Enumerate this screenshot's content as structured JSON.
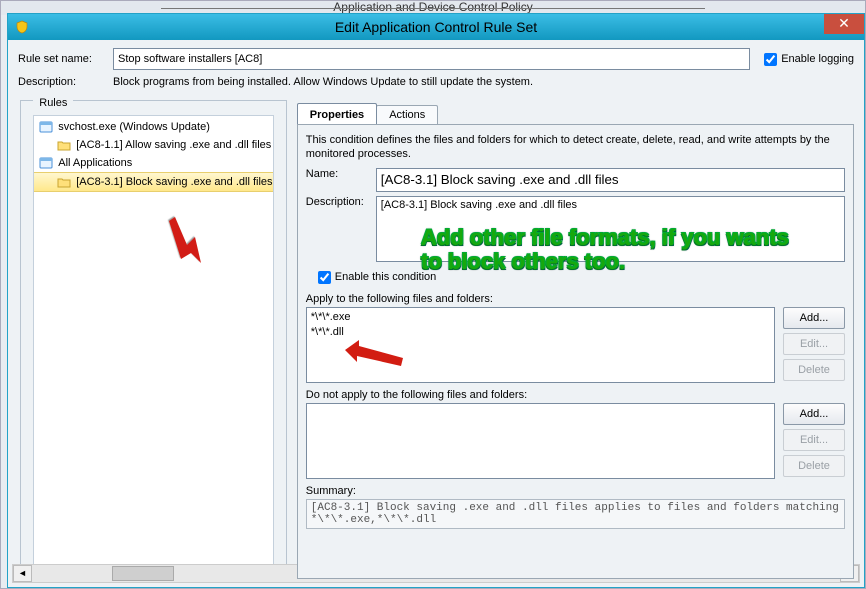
{
  "parent_title": "Application and Device Control Policy",
  "dialog": {
    "title": "Edit Application Control Rule Set",
    "close_glyph": "✕"
  },
  "ruleset": {
    "name_label": "Rule set name:",
    "name_value": "Stop software installers [AC8]",
    "enable_logging_label": "Enable logging",
    "enable_logging_checked": true,
    "desc_label": "Description:",
    "desc_value": "Block programs from being installed.  Allow Windows Update to still update the system."
  },
  "rules_group_label": "Rules",
  "tree": [
    {
      "label": "svchost.exe (Windows Update)",
      "indent": 0,
      "icon": "app",
      "selected": false
    },
    {
      "label": "[AC8-1.1] Allow saving .exe and .dll files",
      "indent": 1,
      "icon": "cond",
      "selected": false
    },
    {
      "label": "All Applications",
      "indent": 0,
      "icon": "app",
      "selected": false
    },
    {
      "label": "[AC8-3.1] Block saving .exe and .dll files",
      "indent": 1,
      "icon": "cond",
      "selected": true
    }
  ],
  "tabs": {
    "properties": "Properties",
    "actions": "Actions"
  },
  "properties": {
    "intro": "This condition defines the files and folders for which to detect create, delete, read, and write attempts by the monitored processes.",
    "name_label": "Name:",
    "name_value": "[AC8-3.1] Block saving .exe and .dll files",
    "desc_label": "Description:",
    "desc_value": "[AC8-3.1] Block saving .exe and .dll files",
    "enable_label": "Enable this condition",
    "enable_checked": true,
    "apply_label": "Apply to the following files and folders:",
    "apply_items": [
      "*\\*\\*.exe",
      "*\\*\\*.dll"
    ],
    "noapply_label": "Do not apply to the following files and folders:",
    "noapply_items": [],
    "buttons": {
      "add": "Add...",
      "edit": "Edit...",
      "delete": "Delete"
    },
    "summary_label": "Summary:",
    "summary_text": "[AC8-3.1] Block saving .exe and .dll files applies to files and folders matching *\\*\\*.exe,*\\*\\*.dll"
  },
  "annotation": {
    "line1": "Add other file formats, if you wants",
    "line2": "to block others too."
  }
}
